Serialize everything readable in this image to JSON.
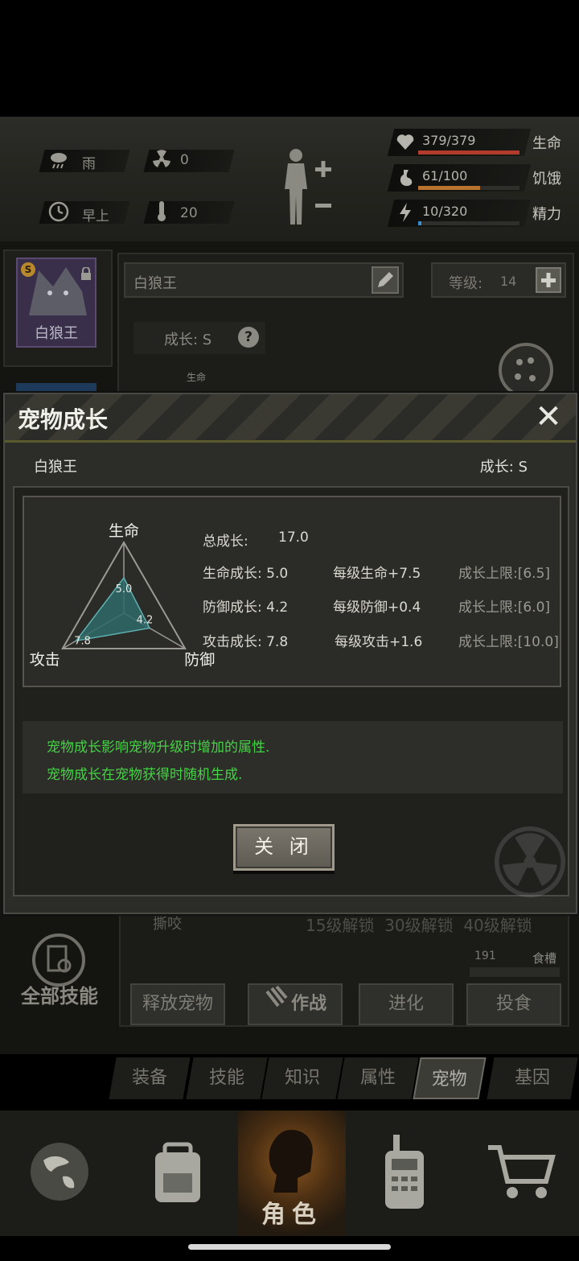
{
  "status": {
    "weather": "雨",
    "radiation": "0",
    "time_of_day": "早上",
    "temperature": "20",
    "health": {
      "text": "379/379",
      "label": "生命",
      "fraction": 1.0,
      "color": "#b23b2b"
    },
    "hunger": {
      "text": "61/100",
      "label": "饥饿",
      "fraction": 0.61,
      "color": "#b8732e"
    },
    "energy": {
      "text": "10/320",
      "label": "精力",
      "fraction": 0.03,
      "color": "#3a8fd0"
    }
  },
  "pet_panel": {
    "portrait_name": "白狼王",
    "portrait_rank": "S",
    "name_field": "白狼王",
    "level_label": "等级:",
    "level_value": "14",
    "growth_label": "成长: S",
    "mini_life": "生命",
    "skill_row": "撕咬",
    "unlock_text": "15级解锁  30级解锁  40级解锁",
    "food_value": "191",
    "food_label": "食槽",
    "all_skills": "全部技能",
    "actions": [
      "释放宠物",
      "作战",
      "进化",
      "投食"
    ]
  },
  "modal": {
    "title": "宠物成长",
    "pet_name": "白狼王",
    "growth": "成长: S",
    "radar": {
      "labels": {
        "top": "生命",
        "left": "攻击",
        "right": "防御"
      },
      "values": {
        "life": "5.0",
        "defense": "4.2",
        "attack": "7.8"
      },
      "max": 10
    },
    "stats": [
      {
        "left": "总成长:",
        "value": "17.0",
        "mid": "",
        "right": ""
      },
      {
        "left": "生命成长: 5.0",
        "mid": "每级生命+7.5",
        "right": "成长上限:[6.5]"
      },
      {
        "left": "防御成长: 4.2",
        "mid": "每级防御+0.4",
        "right": "成长上限:[6.0]"
      },
      {
        "left": "攻击成长: 7.8",
        "mid": "每级攻击+1.6",
        "right": "成长上限:[10.0]"
      }
    ],
    "tips": [
      "宠物成长影响宠物升级时增加的属性.",
      "宠物成长在宠物获得时随机生成."
    ],
    "close_button": "关 闭"
  },
  "tabs": [
    "装备",
    "技能",
    "知识",
    "属性",
    "宠物",
    "基因"
  ],
  "active_tab": "宠物",
  "nav": {
    "active_label": "角色"
  },
  "icons": [
    "cloud-rain-icon",
    "radiation-icon",
    "clock-icon",
    "thermometer-icon",
    "body-icon",
    "heart-icon",
    "stomach-icon",
    "bolt-icon",
    "edit-icon",
    "plus-icon",
    "help-icon",
    "paw-icon",
    "close-icon",
    "globe-icon",
    "backpack-icon",
    "head-icon",
    "radio-icon",
    "cart-icon"
  ]
}
